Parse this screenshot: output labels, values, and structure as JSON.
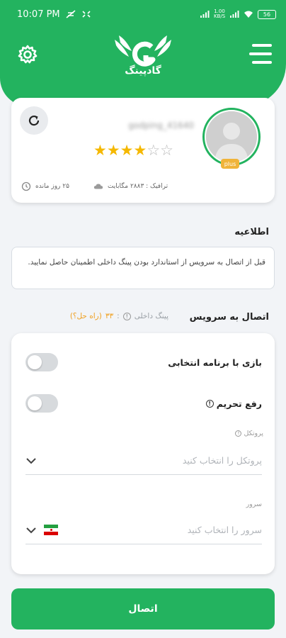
{
  "statusbar": {
    "time": "10:07 PM",
    "battery": "56",
    "data_speed": "1.00\nKB/S"
  },
  "header": {
    "app_name": "گادپینگ",
    "brand_color": "#23b35f"
  },
  "profile": {
    "username": "godping_41640",
    "badge": "plus",
    "rating": 4,
    "rating_max": 6,
    "traffic": "ترافیک : ۲۸۸۳ مگابایت",
    "days_left": "۲۵ روز مانده"
  },
  "info": {
    "title": "اطلاعیه",
    "text": "قبل از اتصال به سرویس از استاندارد بودن پینگ داخلی اطمینان حاصل نمایید."
  },
  "service": {
    "title": "اتصال به سرویس",
    "ping_label": "پینگ داخلی",
    "ping_separator": ":",
    "ping_value": "۳۳",
    "ping_help": "(راه حل؟)",
    "game_toggle_label": "بازی با برنامه انتخابی",
    "unblock_toggle_label": "رفع تحریم",
    "protocol_caption": "پروتکل",
    "protocol_placeholder": "پروتکل را انتخاب کنید",
    "server_caption": "سرور",
    "server_placeholder": "سرور را انتخاب کنید"
  },
  "connect_button": "اتصال",
  "icons": {
    "menu": "menu-icon",
    "settings": "gear-icon",
    "refresh": "refresh-icon",
    "cloud": "cloud-icon",
    "clock": "clock-icon",
    "info": "info-icon",
    "chevron": "chevron-down-icon",
    "flag": "iran-flag-icon"
  }
}
